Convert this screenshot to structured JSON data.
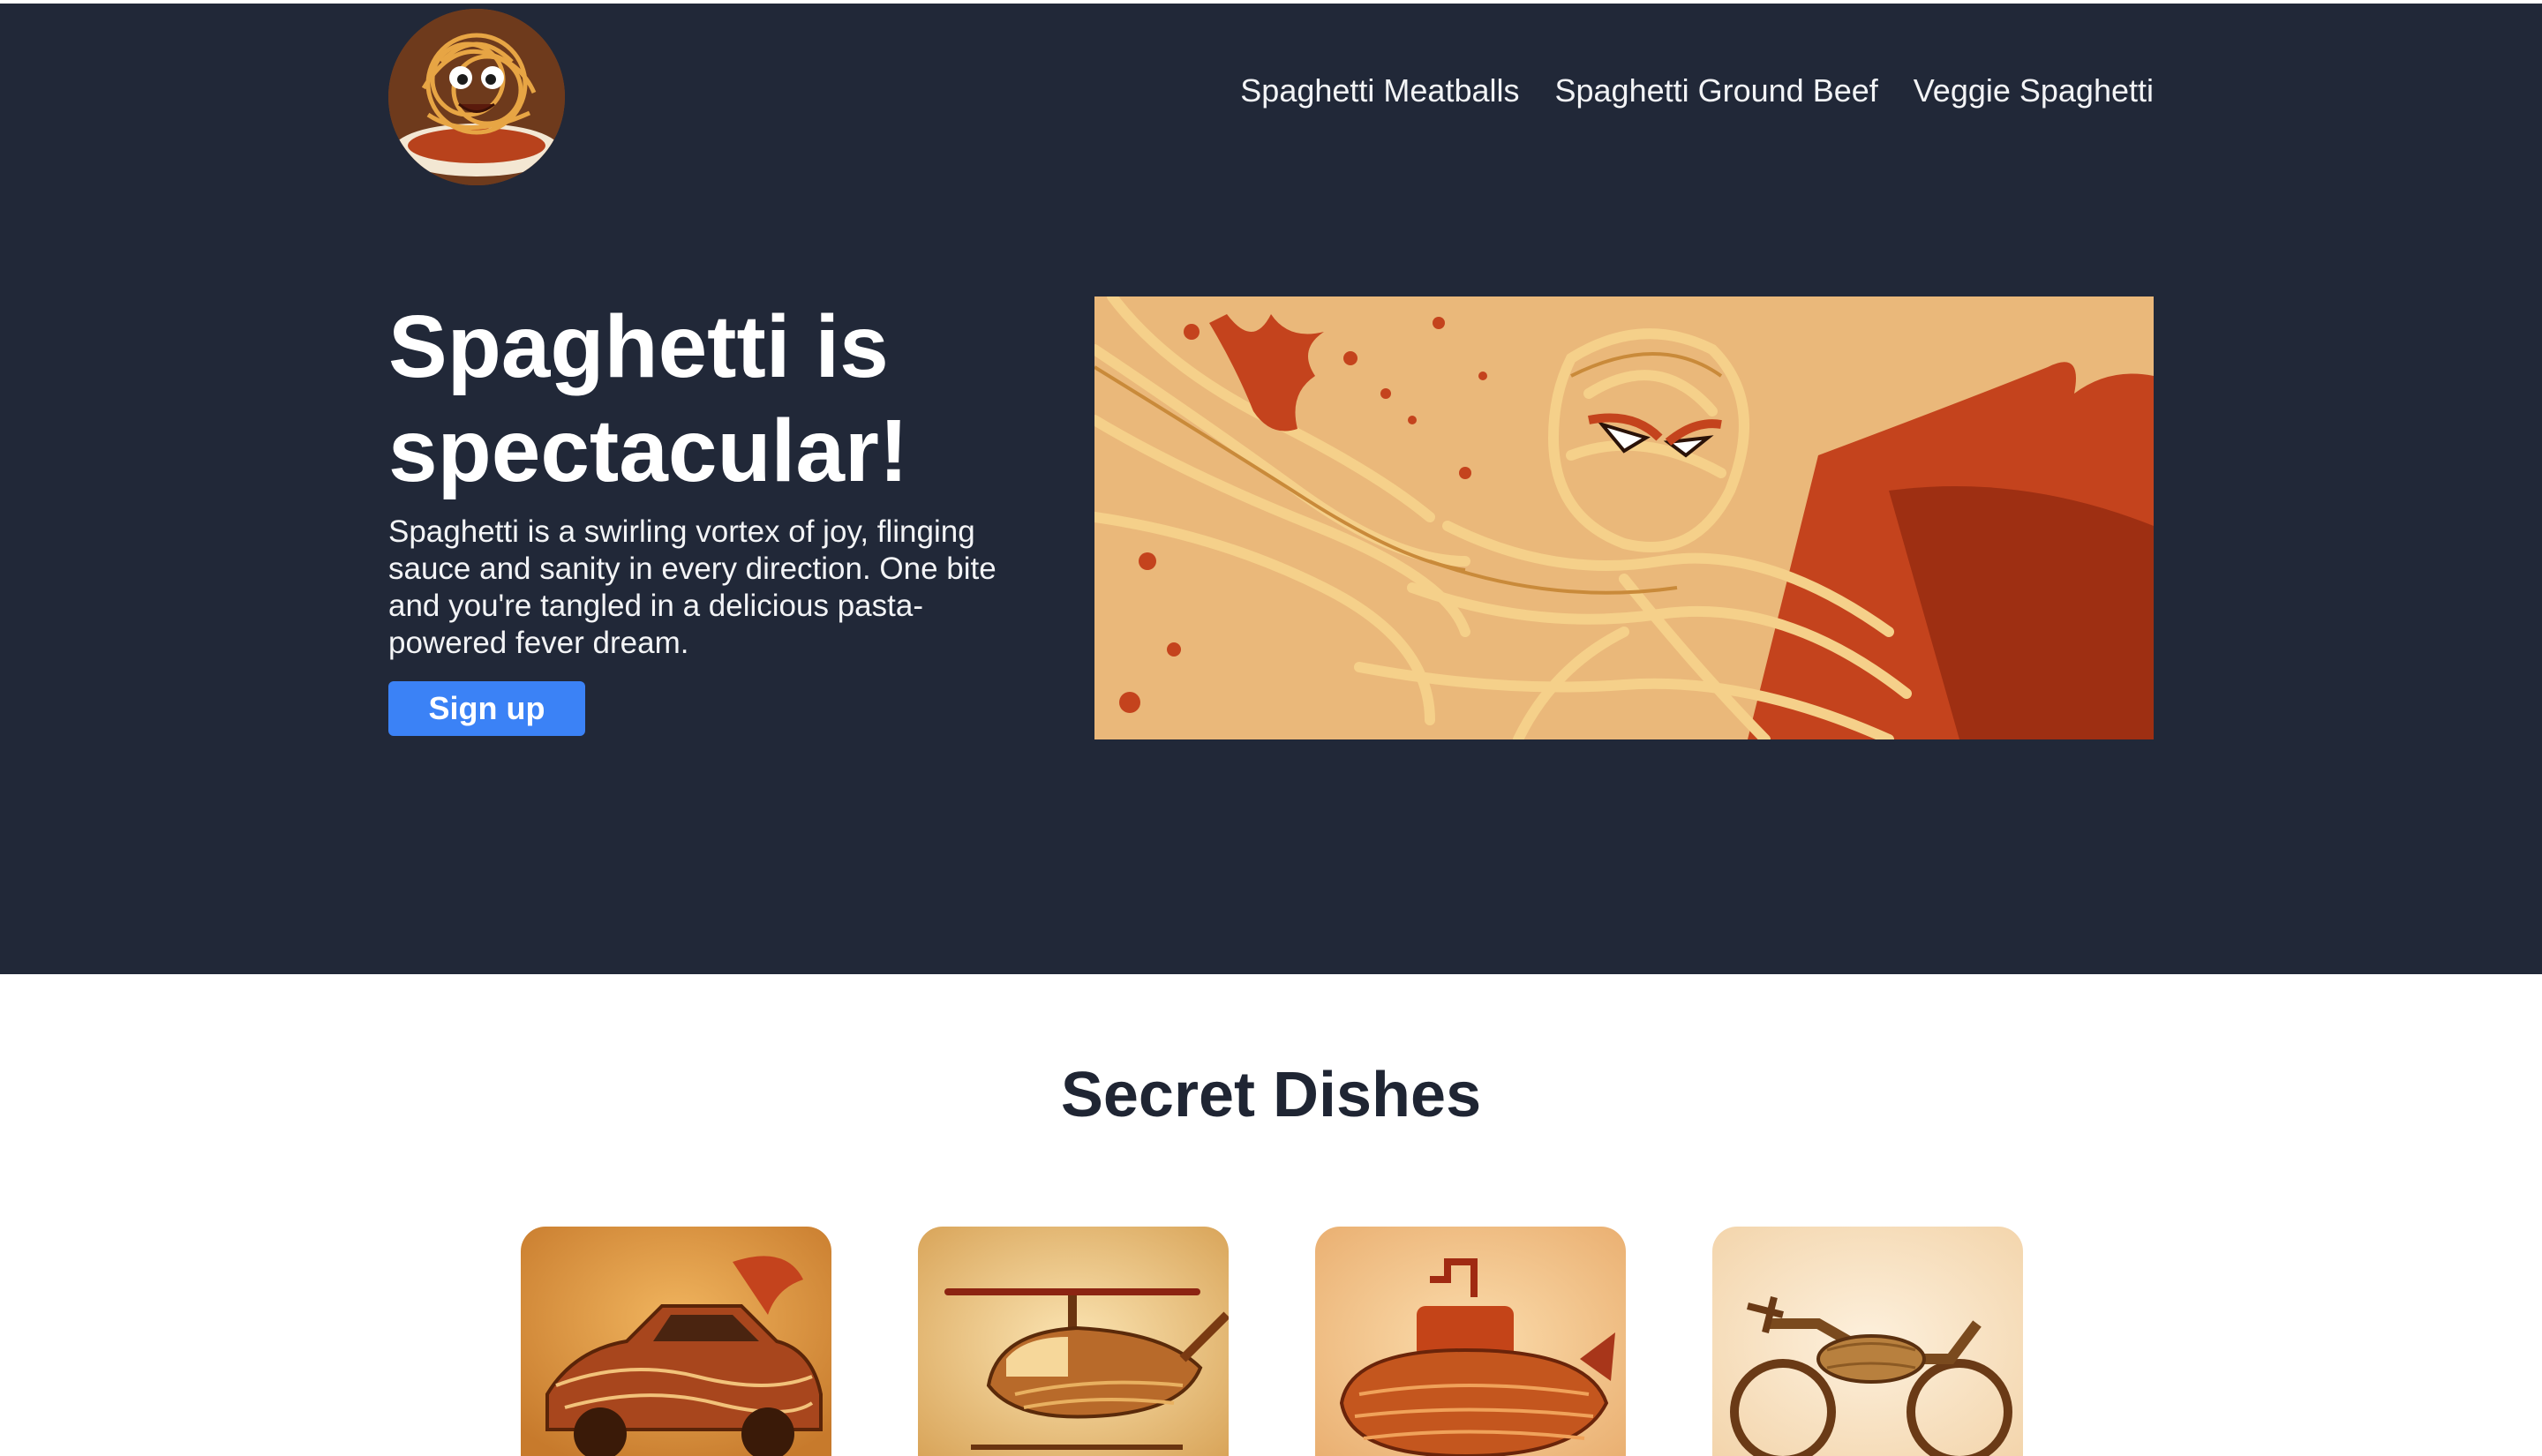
{
  "header": {
    "logo_icon": "spaghetti-monster-icon",
    "nav": [
      {
        "label": "Spaghetti Meatballs"
      },
      {
        "label": "Spaghetti Ground Beef"
      },
      {
        "label": "Veggie Spaghetti"
      }
    ]
  },
  "hero": {
    "title": "Spaghetti is spectacular!",
    "text": "Spaghetti is a swirling vortex of joy, flinging sauce and sanity in every direction. One bite and you're tangled in a delicious pasta-powered fever dream.",
    "signup_label": "Sign up",
    "image_icon": "spaghetti-superhero-illustration"
  },
  "secret": {
    "title": "Secret Dishes",
    "cards": [
      {
        "icon": "spaghetti-car-illustration"
      },
      {
        "icon": "spaghetti-helicopter-illustration"
      },
      {
        "icon": "spaghetti-submarine-illustration"
      },
      {
        "icon": "spaghetti-motorcycle-illustration"
      }
    ]
  },
  "colors": {
    "hero_bg": "#212838",
    "button": "#3b82f6",
    "heading_dark": "#1f2533"
  }
}
